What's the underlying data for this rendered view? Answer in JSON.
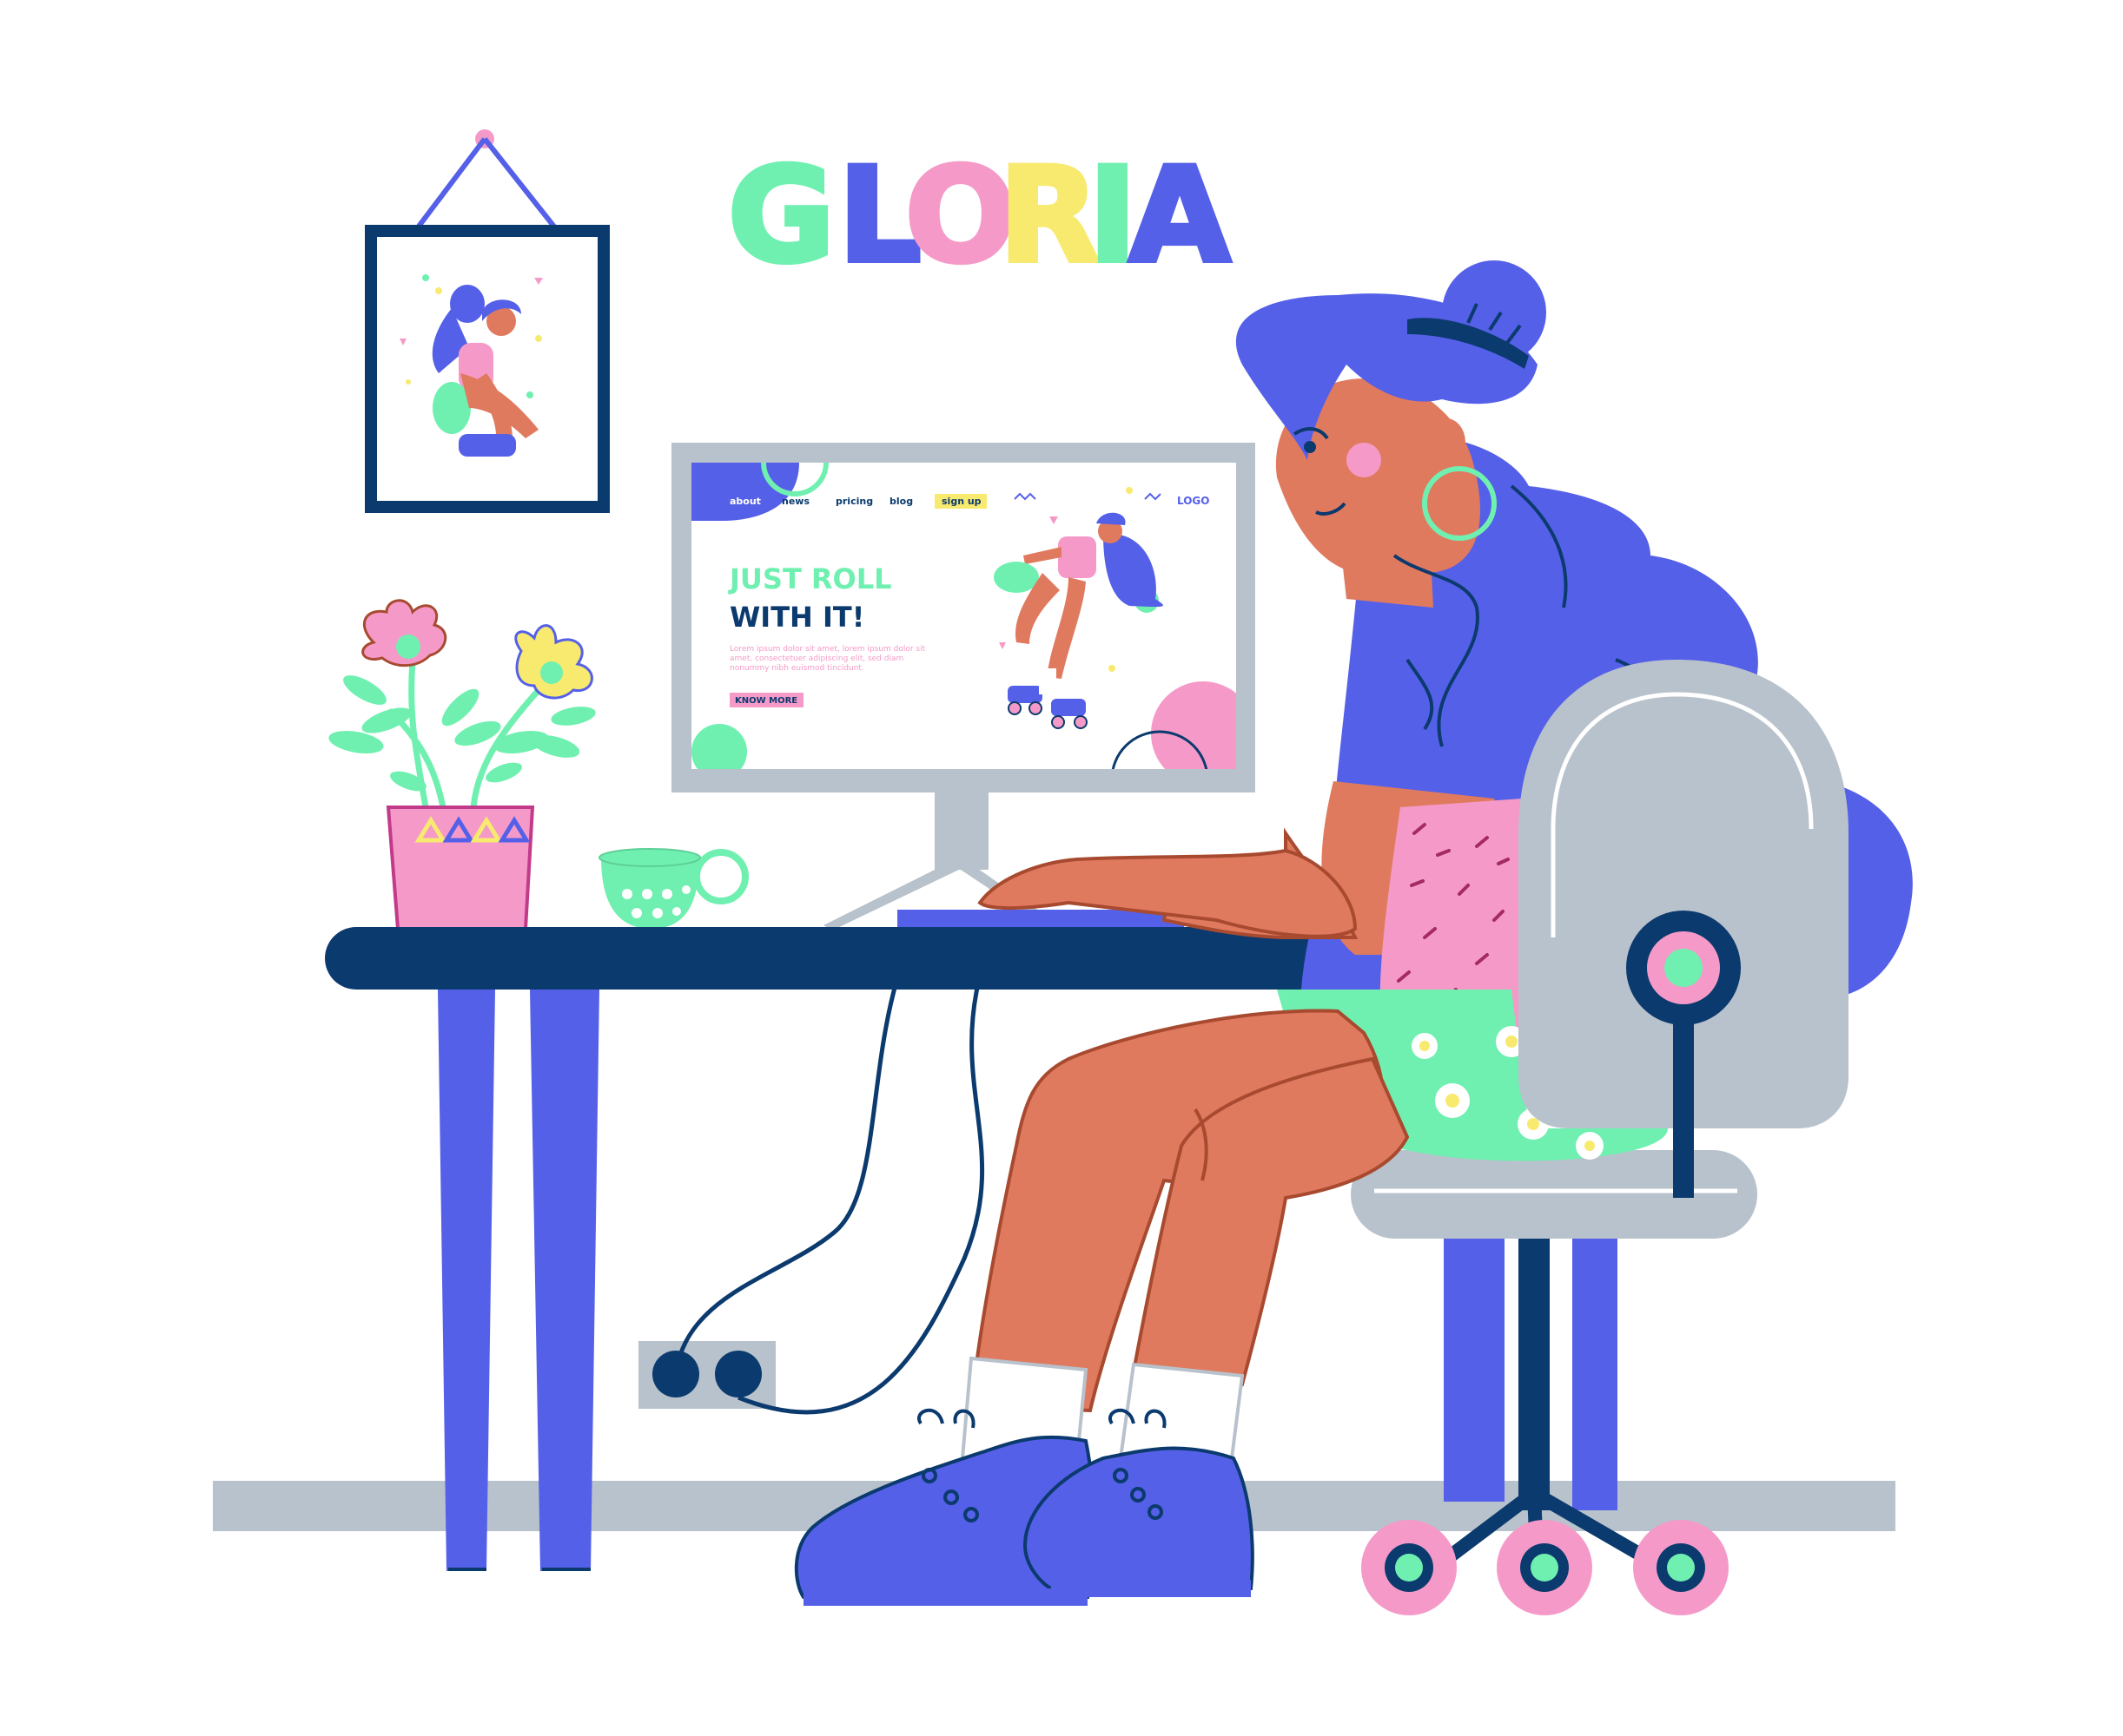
{
  "title": {
    "letters": [
      {
        "char": "G",
        "color": "#6ff0b0"
      },
      {
        "char": "L",
        "color": "#5560e8"
      },
      {
        "char": "O",
        "color": "#f59ac8"
      },
      {
        "char": "R",
        "color": "#f8ea6e"
      },
      {
        "char": "I",
        "color": "#6ff0b0"
      },
      {
        "char": "A",
        "color": "#5560e8"
      }
    ]
  },
  "screen": {
    "nav": {
      "about": "about",
      "news": "news",
      "pricing": "pricing",
      "blog": "blog",
      "signup": "sign up",
      "logo": "LOGO"
    },
    "headline_line1": "JUST ROLL",
    "headline_line2": "WITH IT!",
    "body_lines": [
      "Lorem ipsum dolor sit amet, lorem ipsum dolor sit",
      "amet, consectetuer adipiscing elit, sed diam",
      "nonummy nibh euismod tincidunt."
    ],
    "cta": "KNOW MORE"
  },
  "colors": {
    "blue": "#5560e8",
    "navy": "#0b3a6e",
    "pink": "#f59ac8",
    "mint": "#6ff0b0",
    "yellow": "#f8ea6e",
    "grey": "#b8c2cc",
    "skin": "#e07a5f",
    "skin_dark": "#a84a30"
  }
}
